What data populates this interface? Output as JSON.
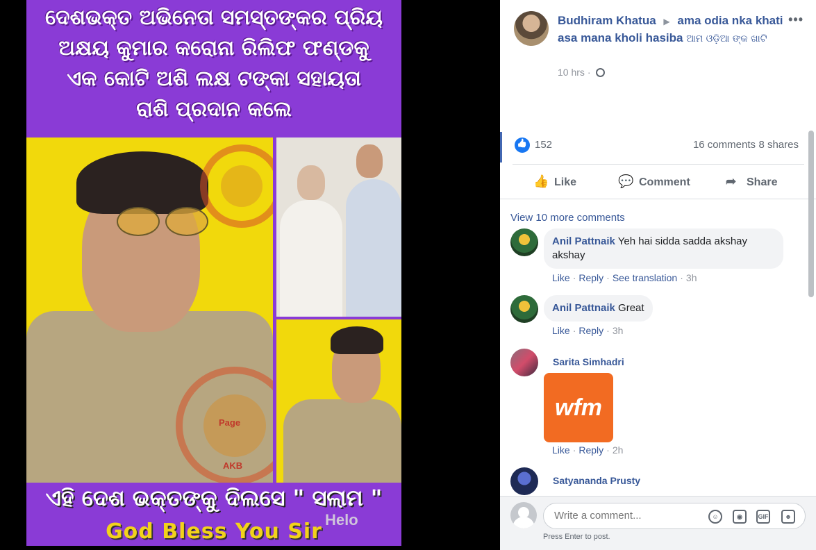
{
  "photo": {
    "headline": [
      "ଦେଶଭକ୍ତ ଅଭିନେତା ସମସ୍ତଙ୍କର ପ୍ରିୟ",
      "ଅକ୍ଷୟ କୁମାର କରୋନା ରିଲିଫ ଫଣ୍ଡକୁ",
      "ଏକ କୋଟି ଅଶି ଲକ୍ଷ ଟଙ୍କା ସହାୟତା",
      "ରାଶି ପ୍ରଦାନ କଲେ"
    ],
    "stamp_text": "AKSHAYA KUMAR BEHERA",
    "stamp_page": "Page",
    "stamp_akb": "AKB",
    "caption": "ଏହି ଦେଶ ଭକ୍ତଙ୍କୁ ଦିଲସେ \" ସଲାମ \"",
    "bless": "God Bless You Sir",
    "watermark": "Helo"
  },
  "post": {
    "author": "Budhiram Khatua",
    "group": "ama odia nka khati asa mana kholi hasiba",
    "group_odia": "ଆମ ଓଡ଼ିଆ ଙ୍କ ଖାଟି",
    "time": "10 hrs",
    "more": "•••",
    "reactions": "152",
    "comments_count": "16 comments",
    "shares_count": "8 shares"
  },
  "actions": {
    "like": "Like",
    "comment": "Comment",
    "share": "Share"
  },
  "comments": {
    "view_more": "View 10 more comments",
    "like": "Like",
    "reply": "Reply",
    "see_translation": "See translation",
    "items": [
      {
        "name": "Anil Pattnaik",
        "text": "Yeh hai sidda sadda akshay akshay",
        "time": "3h"
      },
      {
        "name": "Anil Pattnaik",
        "text": "Great",
        "time": "3h"
      },
      {
        "name": "Sarita Simhadri",
        "sticker": "wfm",
        "time": "2h"
      },
      {
        "name": "Satyananda Prusty"
      }
    ]
  },
  "composer": {
    "placeholder": "Write a comment...",
    "hint": "Press Enter to post.",
    "gif": "GIF"
  }
}
